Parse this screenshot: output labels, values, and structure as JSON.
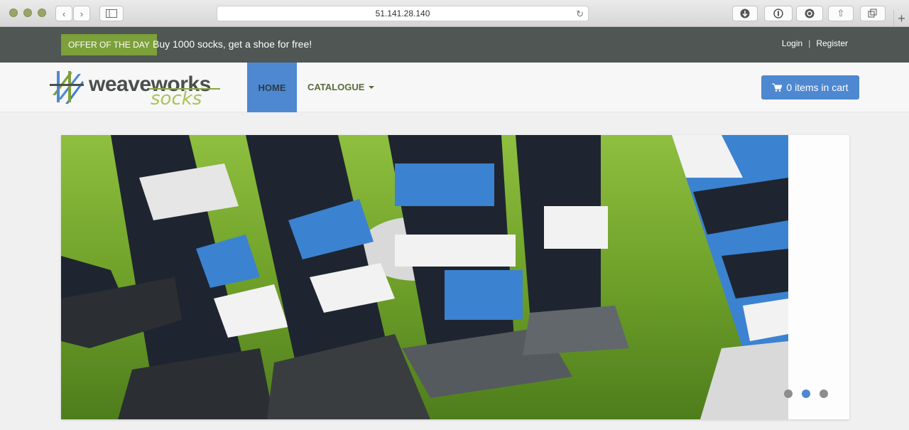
{
  "browser": {
    "url": "51.141.28.140"
  },
  "topbar": {
    "offer_badge": "OFFER OF THE DAY",
    "offer_text": "Buy 1000 socks, get a shoe for free!",
    "login": "Login",
    "separator": "|",
    "register": "Register"
  },
  "logo": {
    "word": "weaveworks",
    "sub": "socks"
  },
  "nav": {
    "home": "HOME",
    "catalogue": "CATALOGUE",
    "cart": "0 items in cart"
  },
  "carousel": {
    "slides": 3,
    "active_index": 1
  },
  "colors": {
    "accent": "#4e88d0",
    "offer_green": "#7ca03a",
    "topbar": "#4f5654"
  }
}
